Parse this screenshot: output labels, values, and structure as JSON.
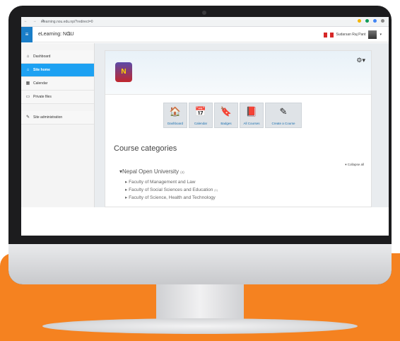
{
  "browser": {
    "url": "elearning.nou.edu.np/?redirect=0"
  },
  "appbar": {
    "site_name": "eLearning: NOU",
    "user_name": "Sudarsan Raj Pant"
  },
  "sidebar": {
    "items": [
      {
        "label": "Dashboard",
        "icon": "home-icon"
      },
      {
        "label": "Site home",
        "icon": "home-icon"
      },
      {
        "label": "Calendar",
        "icon": "calendar-icon"
      },
      {
        "label": "Private files",
        "icon": "file-icon"
      },
      {
        "label": "Site administration",
        "icon": "wrench-icon"
      }
    ]
  },
  "tiles": [
    {
      "label": "Dashboard",
      "icon": "home-icon",
      "glyph": "🏠"
    },
    {
      "label": "Calendar",
      "icon": "calendar-icon",
      "glyph": "📅"
    },
    {
      "label": "Badges",
      "icon": "bookmark-icon",
      "glyph": "🔖"
    },
    {
      "label": "All Courses",
      "icon": "book-icon",
      "glyph": "📕"
    },
    {
      "label": "Create a Course",
      "icon": "edit-icon",
      "glyph": "✎"
    }
  ],
  "course_categories": {
    "title": "Course categories",
    "collapse_label": "Collapse all",
    "root": {
      "name": "Nepal Open University",
      "count": "(4)"
    },
    "subcategories": [
      {
        "name": "Faculty of Management and Law",
        "count": ""
      },
      {
        "name": "Faculty of Social Sciences and Education",
        "count": "(1)"
      },
      {
        "name": "Faculty of Science, Health and Technology",
        "count": ""
      }
    ]
  },
  "colors": {
    "orange": "#f58220",
    "accent_blue": "#1da1f2"
  }
}
